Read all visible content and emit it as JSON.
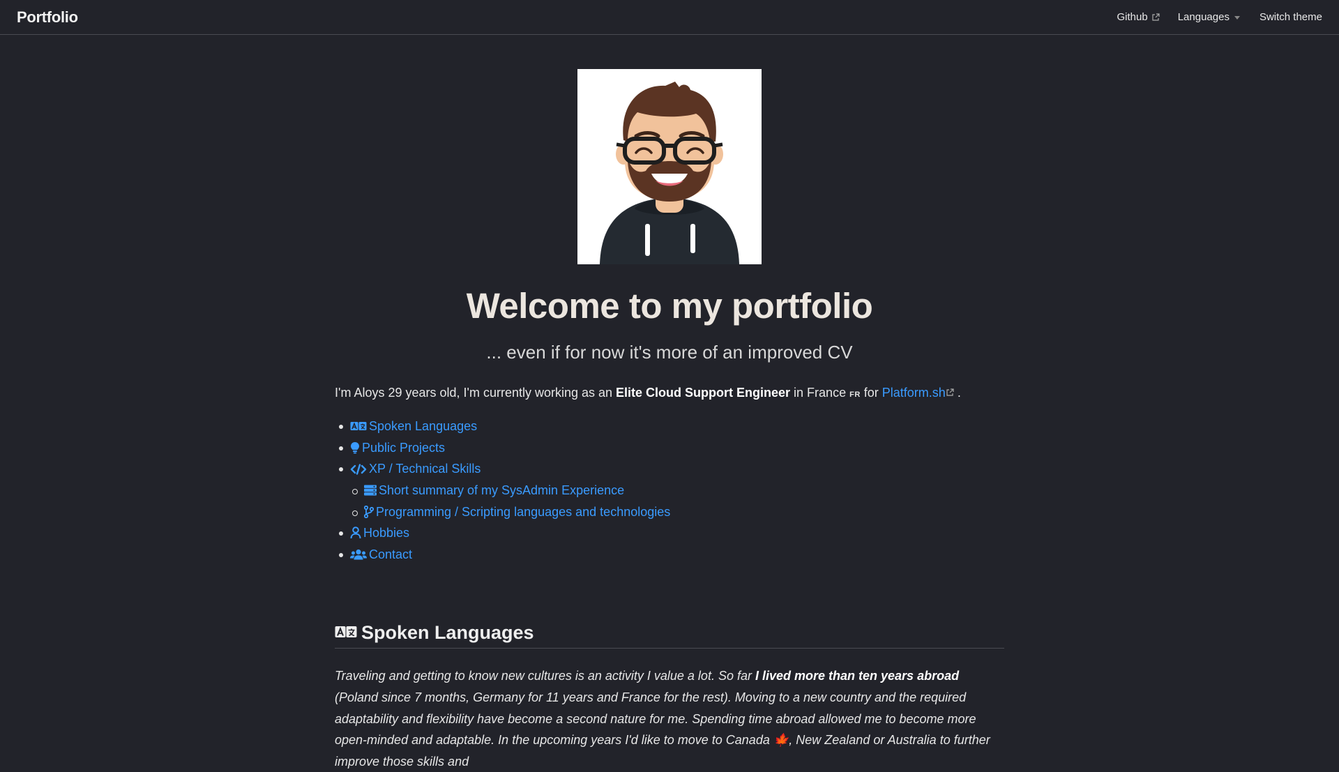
{
  "navbar": {
    "brand": "Portfolio",
    "links": [
      {
        "label": "Github",
        "icon": "external-link-icon"
      },
      {
        "label": "Languages",
        "icon": "caret-down-icon"
      },
      {
        "label": "Switch theme"
      }
    ]
  },
  "hero": {
    "avatar_alt": "Cartoon avatar of a bearded man with glasses wearing a dark hoodie",
    "title": "Welcome to my portfolio",
    "subtitle": "... even if for now it's more of an improved CV"
  },
  "intro": {
    "prefix": "I'm Aloys 29 years old, I'm currently working as an ",
    "role": "Elite Cloud Support Engineer",
    "middle": " in France ",
    "flag": "FR",
    "connector": " for ",
    "company": "Platform.sh",
    "suffix": " ."
  },
  "toc": [
    {
      "label": "Spoken Languages",
      "icon": "language-icon"
    },
    {
      "label": "Public Projects",
      "icon": "lightbulb-icon"
    },
    {
      "label": "XP / Technical Skills",
      "icon": "code-icon"
    },
    {
      "label": "Short summary of my SysAdmin Experience",
      "icon": "server-icon",
      "sub": true
    },
    {
      "label": "Programming / Scripting languages and technologies",
      "icon": "code-branch-icon",
      "sub": true
    },
    {
      "label": "Hobbies",
      "icon": "user-icon"
    },
    {
      "label": "Contact",
      "icon": "users-icon"
    }
  ],
  "spoken_languages": {
    "heading": "Spoken Languages",
    "icon": "language-icon",
    "text_part1": "Traveling and getting to know new cultures is an activity I value a lot. So far ",
    "text_strong": "I lived more than ten years abroad",
    "text_part2": " (Poland since 7 months, Germany for 11 years and France for the rest). Moving to a new country and the required adaptability and flexibility have become a second nature for me. Spending time abroad allowed me to become more open-minded and adaptable. In the upcoming years I'd like to move to Canada ",
    "text_maple": "🍁",
    "text_part3": ", New Zealand or Australia to further improve those skills and"
  },
  "colors": {
    "background": "#22232a",
    "link": "#3a9bff",
    "text": "#e6e6e6",
    "border": "#4a4b52"
  }
}
